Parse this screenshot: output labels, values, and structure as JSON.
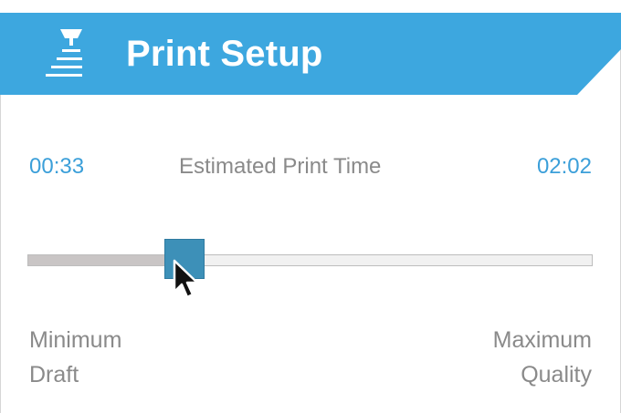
{
  "header": {
    "title": "Print Setup",
    "icon": "printer-icon",
    "color": "#3da7df"
  },
  "time": {
    "min": "00:33",
    "label": "Estimated Print Time",
    "max": "02:02"
  },
  "slider": {
    "value": 0.26,
    "min_label_line1": "Minimum",
    "min_label_line2": "Draft",
    "max_label_line1": "Maximum",
    "max_label_line2": "Quality",
    "thumb_color": "#3d90b8"
  }
}
